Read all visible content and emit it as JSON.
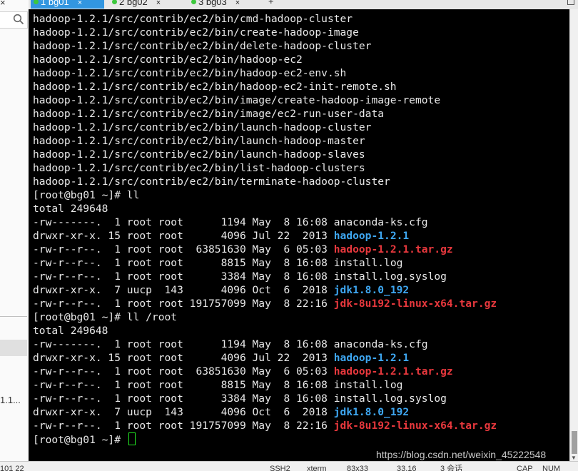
{
  "window": {
    "tabs": [
      {
        "label": "1 bg01",
        "active": true
      },
      {
        "label": "2 bg02",
        "active": false
      },
      {
        "label": "3 bg03",
        "active": false
      }
    ],
    "tab_close_glyph": "×",
    "new_tab_glyph": "+",
    "close_glyph": "×"
  },
  "left_panel": {
    "close_glyph": "×",
    "truncated_item": "1.1..."
  },
  "terminal": {
    "lines": [
      {
        "segments": [
          {
            "text": "hadoop-1.2.1/src/contrib/ec2/bin/cmd-hadoop-cluster",
            "style": "plain"
          }
        ]
      },
      {
        "segments": [
          {
            "text": "hadoop-1.2.1/src/contrib/ec2/bin/create-hadoop-image",
            "style": "plain"
          }
        ]
      },
      {
        "segments": [
          {
            "text": "hadoop-1.2.1/src/contrib/ec2/bin/delete-hadoop-cluster",
            "style": "plain"
          }
        ]
      },
      {
        "segments": [
          {
            "text": "hadoop-1.2.1/src/contrib/ec2/bin/hadoop-ec2",
            "style": "plain"
          }
        ]
      },
      {
        "segments": [
          {
            "text": "hadoop-1.2.1/src/contrib/ec2/bin/hadoop-ec2-env.sh",
            "style": "plain"
          }
        ]
      },
      {
        "segments": [
          {
            "text": "hadoop-1.2.1/src/contrib/ec2/bin/hadoop-ec2-init-remote.sh",
            "style": "plain"
          }
        ]
      },
      {
        "segments": [
          {
            "text": "hadoop-1.2.1/src/contrib/ec2/bin/image/create-hadoop-image-remote",
            "style": "plain"
          }
        ]
      },
      {
        "segments": [
          {
            "text": "hadoop-1.2.1/src/contrib/ec2/bin/image/ec2-run-user-data",
            "style": "plain"
          }
        ]
      },
      {
        "segments": [
          {
            "text": "hadoop-1.2.1/src/contrib/ec2/bin/launch-hadoop-cluster",
            "style": "plain"
          }
        ]
      },
      {
        "segments": [
          {
            "text": "hadoop-1.2.1/src/contrib/ec2/bin/launch-hadoop-master",
            "style": "plain"
          }
        ]
      },
      {
        "segments": [
          {
            "text": "hadoop-1.2.1/src/contrib/ec2/bin/launch-hadoop-slaves",
            "style": "plain"
          }
        ]
      },
      {
        "segments": [
          {
            "text": "hadoop-1.2.1/src/contrib/ec2/bin/list-hadoop-clusters",
            "style": "plain"
          }
        ]
      },
      {
        "segments": [
          {
            "text": "hadoop-1.2.1/src/contrib/ec2/bin/terminate-hadoop-cluster",
            "style": "plain"
          }
        ]
      },
      {
        "segments": [
          {
            "text": "[root@bg01 ~]# ll",
            "style": "plain"
          }
        ]
      },
      {
        "segments": [
          {
            "text": "total 249648",
            "style": "plain"
          }
        ]
      },
      {
        "segments": [
          {
            "text": "-rw-------.  1 root root      1194 May  8 16:08 ",
            "style": "plain"
          },
          {
            "text": "anaconda-ks.cfg",
            "style": "plain"
          }
        ]
      },
      {
        "segments": [
          {
            "text": "drwxr-xr-x. 15 root root      4096 Jul 22  2013 ",
            "style": "plain"
          },
          {
            "text": "hadoop-1.2.1",
            "style": "dir"
          }
        ]
      },
      {
        "segments": [
          {
            "text": "-rw-r--r--.  1 root root  63851630 May  6 05:03 ",
            "style": "plain"
          },
          {
            "text": "hadoop-1.2.1.tar.gz",
            "style": "archive"
          }
        ]
      },
      {
        "segments": [
          {
            "text": "-rw-r--r--.  1 root root      8815 May  8 16:08 ",
            "style": "plain"
          },
          {
            "text": "install.log",
            "style": "plain"
          }
        ]
      },
      {
        "segments": [
          {
            "text": "-rw-r--r--.  1 root root      3384 May  8 16:08 ",
            "style": "plain"
          },
          {
            "text": "install.log.syslog",
            "style": "plain"
          }
        ]
      },
      {
        "segments": [
          {
            "text": "drwxr-xr-x.  7 uucp  143      4096 Oct  6  2018 ",
            "style": "plain"
          },
          {
            "text": "jdk1.8.0_192",
            "style": "dir"
          }
        ]
      },
      {
        "segments": [
          {
            "text": "-rw-r--r--.  1 root root 191757099 May  8 22:16 ",
            "style": "plain"
          },
          {
            "text": "jdk-8u192-linux-x64.tar.gz",
            "style": "archive"
          }
        ]
      },
      {
        "segments": [
          {
            "text": "[root@bg01 ~]# ll /root",
            "style": "plain"
          }
        ]
      },
      {
        "segments": [
          {
            "text": "total 249648",
            "style": "plain"
          }
        ]
      },
      {
        "segments": [
          {
            "text": "-rw-------.  1 root root      1194 May  8 16:08 ",
            "style": "plain"
          },
          {
            "text": "anaconda-ks.cfg",
            "style": "plain"
          }
        ]
      },
      {
        "segments": [
          {
            "text": "drwxr-xr-x. 15 root root      4096 Jul 22  2013 ",
            "style": "plain"
          },
          {
            "text": "hadoop-1.2.1",
            "style": "dir"
          }
        ]
      },
      {
        "segments": [
          {
            "text": "-rw-r--r--.  1 root root  63851630 May  6 05:03 ",
            "style": "plain"
          },
          {
            "text": "hadoop-1.2.1.tar.gz",
            "style": "archive"
          }
        ]
      },
      {
        "segments": [
          {
            "text": "-rw-r--r--.  1 root root      8815 May  8 16:08 ",
            "style": "plain"
          },
          {
            "text": "install.log",
            "style": "plain"
          }
        ]
      },
      {
        "segments": [
          {
            "text": "-rw-r--r--.  1 root root      3384 May  8 16:08 ",
            "style": "plain"
          },
          {
            "text": "install.log.syslog",
            "style": "plain"
          }
        ]
      },
      {
        "segments": [
          {
            "text": "drwxr-xr-x.  7 uucp  143      4096 Oct  6  2018 ",
            "style": "plain"
          },
          {
            "text": "jdk1.8.0_192",
            "style": "dir"
          }
        ]
      },
      {
        "segments": [
          {
            "text": "-rw-r--r--.  1 root root 191757099 May  8 22:16 ",
            "style": "plain"
          },
          {
            "text": "jdk-8u192-linux-x64.tar.gz",
            "style": "archive"
          }
        ]
      }
    ],
    "prompt": "[root@bg01 ~]# ",
    "watermark": "https://blog.csdn.net/weixin_45222548"
  },
  "colors": {
    "terminal_bg": "#000000",
    "terminal_text": "#e8e8e8",
    "directory": "#3ea7f2",
    "archive": "#e8383d",
    "cursor": "#22e622",
    "active_tab": "#3296e0",
    "connected_dot": "#3cc83c"
  },
  "status_bar": {
    "items": [
      {
        "text": "101 22"
      },
      {
        "text": "SSH2"
      },
      {
        "text": "xterm"
      },
      {
        "text": "83x33"
      },
      {
        "text": "33,16"
      },
      {
        "text": "3 会话"
      },
      {
        "text": "CAP"
      },
      {
        "text": "NUM"
      }
    ]
  }
}
